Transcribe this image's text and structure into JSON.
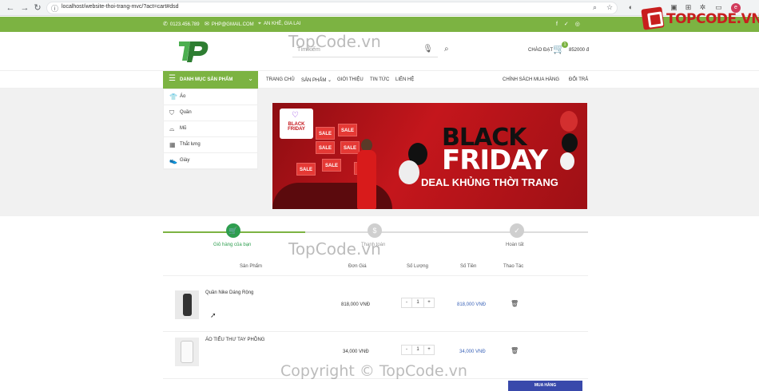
{
  "browser": {
    "url": "localhost/website-thoi-trang-mvc/?act=cart#dsd"
  },
  "brand_overlay": {
    "text": "TOPCODE.VN"
  },
  "topbar": {
    "phone": "0123.456.789",
    "email": "PHP@GMAIL.COM",
    "address": "AN KHÊ, GIA LAI",
    "social": "f ✓ ◎"
  },
  "header": {
    "search_placeholder": "Tìm kiếm",
    "greeting": "CHÀO ĐẠT",
    "cart_count": "1",
    "cart_total": "852000 đ"
  },
  "nav": {
    "category_button": "DANH MỤC SẢN PHẨM",
    "menu": [
      "TRANG CHỦ",
      "SẢN PHẨM ⌄",
      "GIỚI THIỆU",
      "TIN TỨC",
      "LIÊN HỆ"
    ],
    "right": [
      "CHÍNH SÁCH MUA HÀNG",
      "ĐỔI TRẢ"
    ]
  },
  "categories": [
    {
      "label": "Áo",
      "icon": "shirt-icon"
    },
    {
      "label": "Quần",
      "icon": "pants-icon"
    },
    {
      "label": "Mũ",
      "icon": "hat-icon"
    },
    {
      "label": "Thắt lưng",
      "icon": "belt-icon"
    },
    {
      "label": "Giày",
      "icon": "shoe-icon"
    }
  ],
  "banner": {
    "badge": "BLACK FRIDAY",
    "sale": "SALE",
    "title_line1": "BLACK",
    "title_line2": "FRIDAY",
    "subtitle": "DEAL KHỦNG THỜI TRANG"
  },
  "steps": [
    {
      "label": "Giỏ hàng của bạn",
      "active": true
    },
    {
      "label": "Thanh toán",
      "active": false
    },
    {
      "label": "Hoàn tất",
      "active": false
    }
  ],
  "table": {
    "headers": [
      "Sản Phẩm",
      "Đơn Giá",
      "Số Lượng",
      "Số Tiền",
      "Thao Tác"
    ],
    "rows": [
      {
        "name": "Quần Nike Dáng Rộng",
        "price": "818,000 VNĐ",
        "qty": "1",
        "subtotal": "818,000 VNĐ"
      },
      {
        "name": "ÁO TIỂU THƯ TAY PHỒNG",
        "price": "34,000 VNĐ",
        "qty": "1",
        "subtotal": "34,000 VNĐ"
      }
    ],
    "qty_minus": "-",
    "qty_plus": "+"
  },
  "order_button": "MUA HÀNG",
  "watermarks": [
    "TopCode.vn",
    "TopCode.vn",
    "Copyright © TopCode.vn"
  ],
  "colors": {
    "green": "#7cb342",
    "blue": "#3949ab",
    "price_blue": "#3a63b8"
  }
}
